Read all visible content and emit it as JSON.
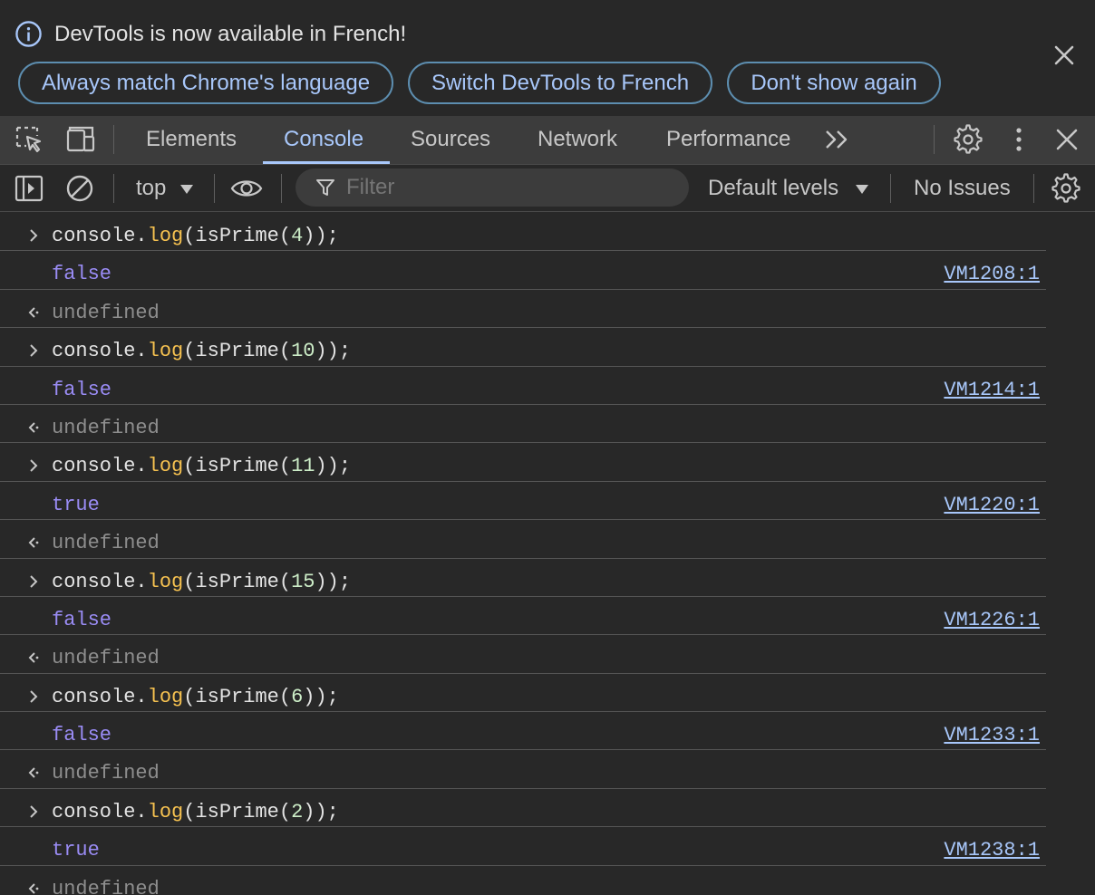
{
  "infobar": {
    "message": "DevTools is now available in French!",
    "buttons": [
      "Always match Chrome's language",
      "Switch DevTools to French",
      "Don't show again"
    ]
  },
  "main_toolbar": {
    "tabs": [
      "Elements",
      "Console",
      "Sources",
      "Network",
      "Performance"
    ],
    "active_tab": "Console",
    "icons": [
      "inspect-element-icon",
      "device-toolbar-icon",
      "more-tabs-icon",
      "settings-icon",
      "more-options-icon",
      "close-icon"
    ]
  },
  "console_toolbar": {
    "context": "top",
    "filter_placeholder": "Filter",
    "levels": "Default levels",
    "issues": "No Issues"
  },
  "log": [
    {
      "type": "input",
      "code": {
        "obj": "console.",
        "fn": "log",
        "pre": "(isPrime(",
        "arg": "4",
        "post": "));"
      }
    },
    {
      "type": "result",
      "value": "false",
      "source": "VM1208:1"
    },
    {
      "type": "return",
      "value": "undefined"
    },
    {
      "type": "input",
      "code": {
        "obj": "console.",
        "fn": "log",
        "pre": "(isPrime(",
        "arg": "10",
        "post": "));"
      }
    },
    {
      "type": "result",
      "value": "false",
      "source": "VM1214:1"
    },
    {
      "type": "return",
      "value": "undefined"
    },
    {
      "type": "input",
      "code": {
        "obj": "console.",
        "fn": "log",
        "pre": "(isPrime(",
        "arg": "11",
        "post": "));"
      }
    },
    {
      "type": "result",
      "value": "true",
      "source": "VM1220:1"
    },
    {
      "type": "return",
      "value": "undefined"
    },
    {
      "type": "input",
      "code": {
        "obj": "console.",
        "fn": "log",
        "pre": "(isPrime(",
        "arg": "15",
        "post": "));"
      }
    },
    {
      "type": "result",
      "value": "false",
      "source": "VM1226:1"
    },
    {
      "type": "return",
      "value": "undefined"
    },
    {
      "type": "input",
      "code": {
        "obj": "console.",
        "fn": "log",
        "pre": "(isPrime(",
        "arg": "6",
        "post": "));"
      }
    },
    {
      "type": "result",
      "value": "false",
      "source": "VM1233:1"
    },
    {
      "type": "return",
      "value": "undefined"
    },
    {
      "type": "input",
      "code": {
        "obj": "console.",
        "fn": "log",
        "pre": "(isPrime(",
        "arg": "2",
        "post": "));"
      }
    },
    {
      "type": "result",
      "value": "true",
      "source": "VM1238:1"
    },
    {
      "type": "return",
      "value": "undefined"
    }
  ],
  "colors": {
    "background": "#282828",
    "toolbar": "#3c3c3c",
    "accent": "#a8c7fa",
    "boolean": "#9a8cf5",
    "function": "#f5c150",
    "number": "#cdeec8",
    "muted": "#8e8e8e"
  }
}
